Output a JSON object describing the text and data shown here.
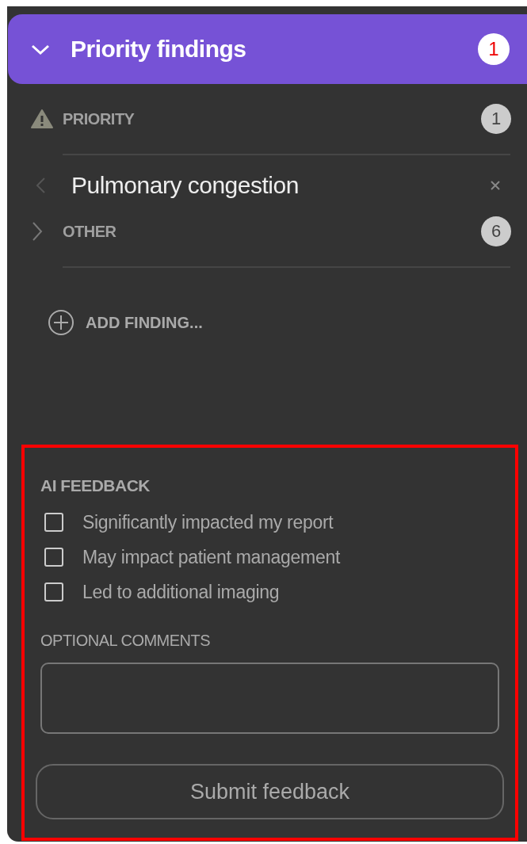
{
  "header": {
    "title": "Priority findings",
    "expanded": true,
    "count": "1"
  },
  "sections": [
    {
      "kind": "priority",
      "label": "PRIORITY",
      "count": "1",
      "findings": [
        {
          "label": "Pulmonary congestion"
        }
      ]
    },
    {
      "kind": "other",
      "label": "OTHER",
      "count": "6",
      "expanded": false
    }
  ],
  "add_finding": "ADD FINDING...",
  "feedback": {
    "title": "AI FEEDBACK",
    "options": [
      {
        "label": "Significantly impacted my report",
        "checked": false
      },
      {
        "label": "May impact patient management",
        "checked": false
      },
      {
        "label": "Led to additional imaging",
        "checked": false
      }
    ],
    "comments_label": "OPTIONAL COMMENTS",
    "submit": "Submit feedback"
  }
}
